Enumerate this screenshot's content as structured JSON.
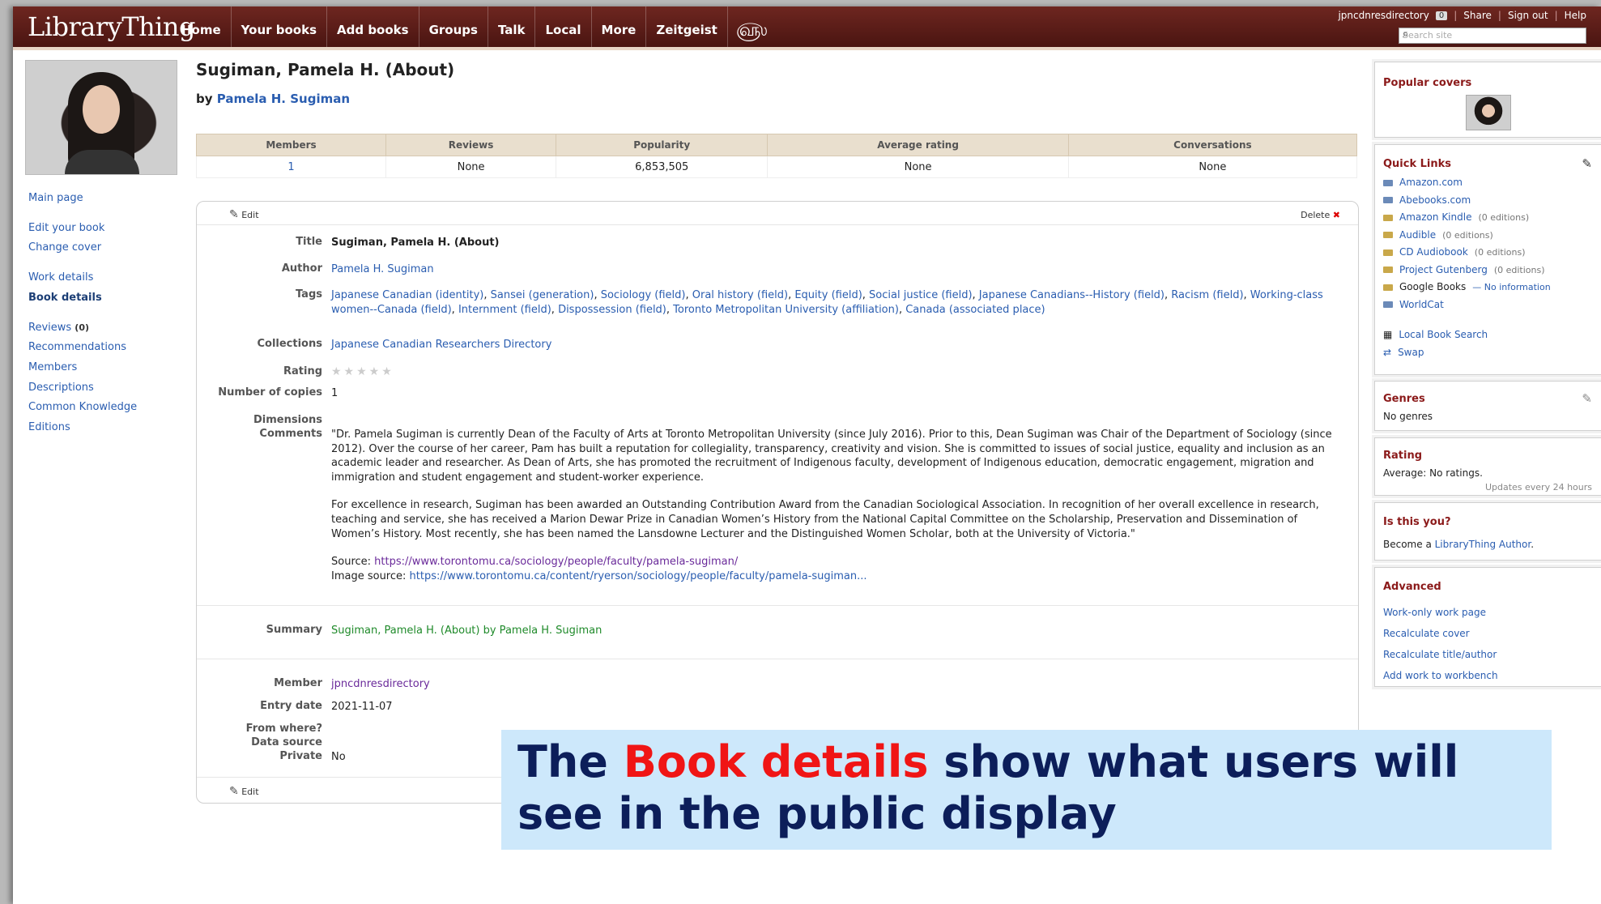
{
  "header": {
    "logo": "LibraryThing",
    "nav": [
      "Home",
      "Your books",
      "Add books",
      "Groups",
      "Talk",
      "Local",
      "More",
      "Zeitgeist"
    ],
    "user": "jpncdnresdirectory",
    "user_badge": "0",
    "share": "Share",
    "sign_out": "Sign out",
    "help": "Help",
    "search_placeholder": "Search site"
  },
  "left_nav": {
    "main_page": "Main page",
    "edit_book": "Edit your book",
    "change_cover": "Change cover",
    "work_details": "Work details",
    "book_details": "Book details",
    "reviews": "Reviews",
    "reviews_count": "(0)",
    "recommendations": "Recommendations",
    "members": "Members",
    "descriptions": "Descriptions",
    "common_knowledge": "Common Knowledge",
    "editions": "Editions"
  },
  "book": {
    "title": "Sugiman, Pamela H. (About)",
    "by_label": "by",
    "author": "Pamela H. Sugiman"
  },
  "stats": {
    "headers": [
      "Members",
      "Reviews",
      "Popularity",
      "Average rating",
      "Conversations"
    ],
    "values": [
      "1",
      "None",
      "6,853,505",
      "None",
      "None"
    ]
  },
  "details": {
    "edit_label": "Edit",
    "delete_label": "Delete",
    "title_label": "Title",
    "title_value": "Sugiman, Pamela H. (About)",
    "author_label": "Author",
    "author_value": "Pamela H. Sugiman",
    "tags_label": "Tags",
    "tags": [
      "Japanese Canadian (identity)",
      "Sansei (generation)",
      "Sociology (field)",
      "Oral history (field)",
      "Equity (field)",
      "Social justice (field)",
      "Japanese Canadians--History (field)",
      "Racism (field)",
      "Working-class women--Canada (field)",
      "Internment (field)",
      "Dispossession (field)",
      "Toronto Metropolitan University (affiliation)",
      "Canada (associated place)"
    ],
    "collections_label": "Collections",
    "collections_value": "Japanese Canadian Researchers Directory",
    "rating_label": "Rating",
    "rating_stars": "★★★★★",
    "copies_label": "Number of copies",
    "copies_value": "1",
    "dimensions_label": "Dimensions",
    "comments_label": "Comments",
    "comments_p1": "\"Dr. Pamela Sugiman is currently Dean of the Faculty of Arts at Toronto Metropolitan University (since July 2016). Prior to this, Dean Sugiman was Chair of the Department of Sociology (since 2012). Over the course of her career, Pam has built a reputation for collegiality, transparency, creativity and vision. She is committed to issues of social justice, equality and inclusion as an academic leader and researcher. As Dean of Arts, she has promoted the recruitment of Indigenous faculty, development of Indigenous education, democratic engagement, migration and immigration and student engagement and student-worker experience.",
    "comments_p2": "For excellence in research, Sugiman has been awarded an Outstanding Contribution Award from the Canadian Sociological Association. In recognition of her overall excellence in research, teaching and service, she has received a Marion Dewar Prize in Canadian Women’s History from the National Capital Committee on the Scholarship, Preservation and Dissemination of Women’s History. Most recently, she has been named the Lansdowne Lecturer and the Distinguished Women Scholar, both at the University of Victoria.\"",
    "source_label": "Source:",
    "source_url": "https://www.torontomu.ca/sociology/people/faculty/pamela-sugiman/",
    "image_source_label": "Image source:",
    "image_source_url": "https://www.torontomu.ca/content/ryerson/sociology/people/faculty/pamela-sugiman...",
    "summary_label": "Summary",
    "summary_value": "Sugiman, Pamela H. (About) by Pamela H. Sugiman",
    "member_label": "Member",
    "member_value": "jpncdnresdirectory",
    "entry_label": "Entry date",
    "entry_value": "2021-11-07",
    "from_label": "From where?",
    "source_data_label": "Data source",
    "private_label": "Private",
    "private_value": "No"
  },
  "sidebar": {
    "popular_covers": "Popular covers",
    "quick_links": "Quick Links",
    "links": [
      {
        "name": "Amazon.com",
        "note": "",
        "color": "#6b8ab8"
      },
      {
        "name": "Abebooks.com",
        "note": "",
        "color": "#6b8ab8"
      },
      {
        "name": "Amazon Kindle",
        "note": "(0 editions)",
        "color": "#c9a84a"
      },
      {
        "name": "Audible",
        "note": "(0 editions)",
        "color": "#c9a84a"
      },
      {
        "name": "CD Audiobook",
        "note": "(0 editions)",
        "color": "#c9a84a"
      },
      {
        "name": "Project Gutenberg",
        "note": "(0 editions)",
        "color": "#c9a84a"
      },
      {
        "name": "Google Books",
        "note": "— No information",
        "color": "#c9a84a"
      },
      {
        "name": "WorldCat",
        "note": "",
        "color": "#6b8ab8"
      }
    ],
    "local_search": "Local Book Search",
    "swap": "Swap",
    "genres_title": "Genres",
    "genres_value": "No genres",
    "rating_title": "Rating",
    "rating_value": "Average: No ratings.",
    "rating_note": "Updates every 24 hours",
    "is_this_you": "Is this you?",
    "become": "Become a",
    "lt_author": "LibraryThing Author",
    "advanced_title": "Advanced",
    "advanced_links": [
      "Work-only work page",
      "Recalculate cover",
      "Recalculate title/author",
      "Add work to workbench"
    ]
  },
  "callout": {
    "part1": "The",
    "highlight": "Book details",
    "part2": "show what users will see in the public display",
    "highlight_color": "#f01515"
  }
}
